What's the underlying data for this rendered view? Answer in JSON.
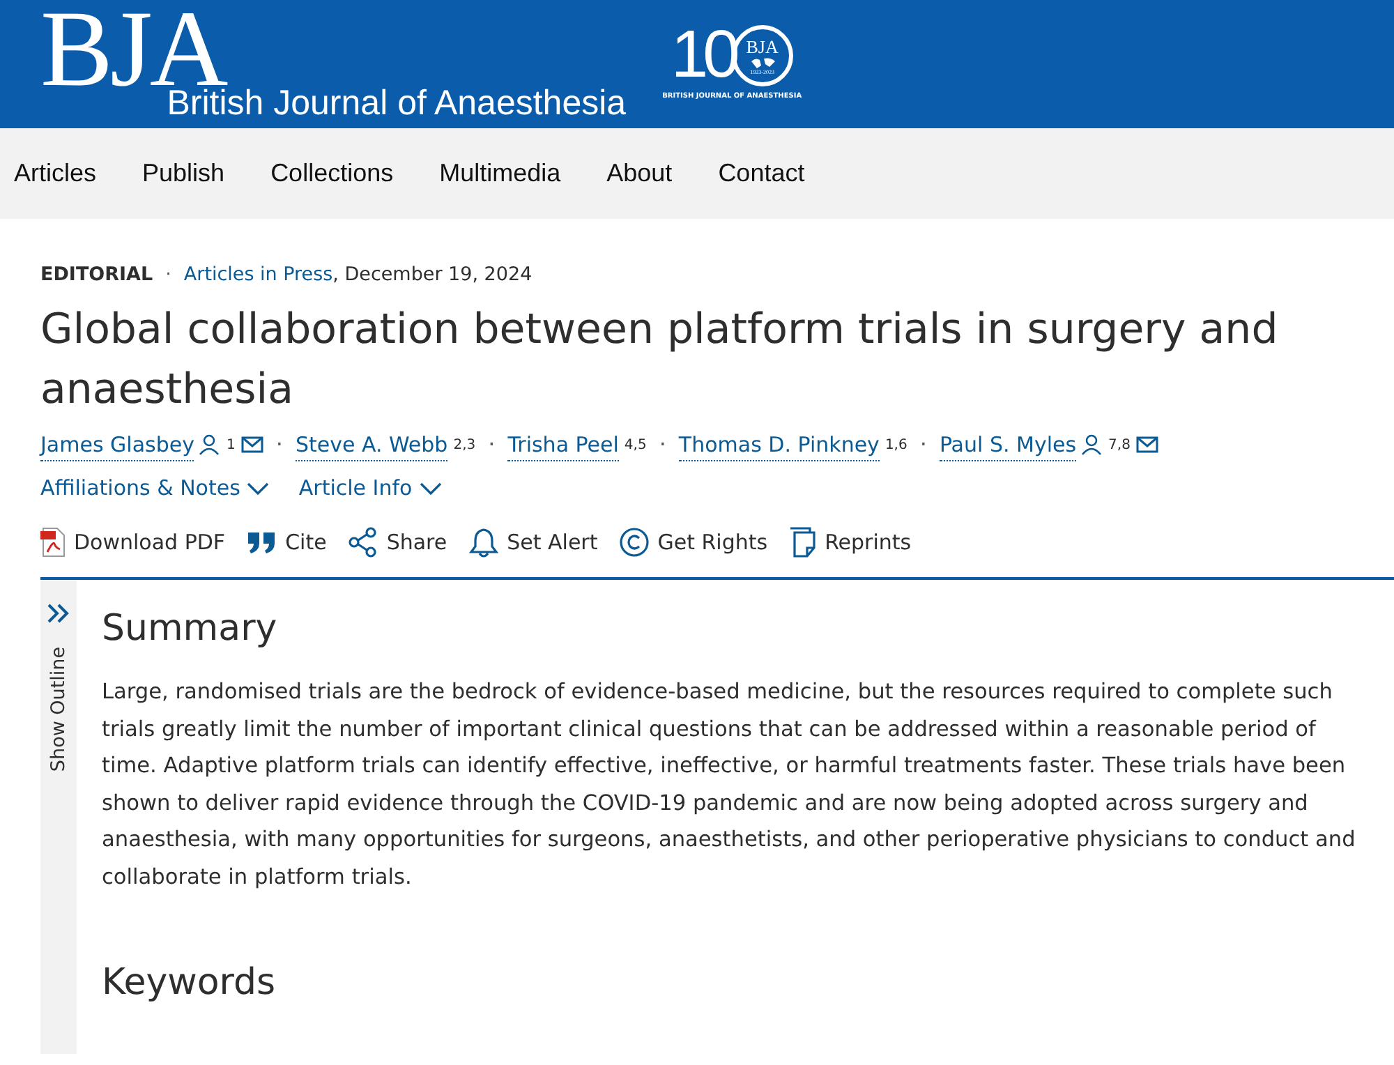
{
  "header": {
    "logo": "BJA",
    "journal": "British Journal of Anaesthesia",
    "anniversary": {
      "number": "10",
      "mark": "BJA",
      "years": "1923-2023",
      "caption": "BRITISH JOURNAL OF ANAESTHESIA"
    }
  },
  "separator": "·",
  "nav": [
    "Articles",
    "Publish",
    "Collections",
    "Multimedia",
    "About",
    "Contact"
  ],
  "article": {
    "type": "EDITORIAL",
    "section": "Articles in Press",
    "date": ", December 19, 2024",
    "title": "Global collaboration between platform trials in surgery and anaesthesia",
    "authors": [
      {
        "name": "James Glasbey",
        "person_icon": true,
        "sup": "1",
        "email_icon": true
      },
      {
        "name": "Steve A. Webb",
        "person_icon": false,
        "sup": "2,3",
        "email_icon": false
      },
      {
        "name": "Trisha Peel",
        "person_icon": false,
        "sup": "4,5",
        "email_icon": false
      },
      {
        "name": "Thomas D. Pinkney",
        "person_icon": false,
        "sup": "1,6",
        "email_icon": false
      },
      {
        "name": "Paul S. Myles",
        "person_icon": true,
        "sup": "7,8",
        "email_icon": true
      }
    ],
    "toggles": [
      "Affiliations & Notes",
      "Article Info"
    ],
    "actions": [
      {
        "kind": "pdf",
        "label": "Download PDF"
      },
      {
        "kind": "cite",
        "label": "Cite"
      },
      {
        "kind": "share",
        "label": "Share"
      },
      {
        "kind": "alert",
        "label": "Set Alert"
      },
      {
        "kind": "rights",
        "label": "Get Rights"
      },
      {
        "kind": "reprints",
        "label": "Reprints"
      }
    ]
  },
  "outline": {
    "label": "Show Outline"
  },
  "sections": [
    {
      "heading": "Summary",
      "text": "Large, randomised trials are the bedrock of evidence-based medicine, but the resources required to complete such trials greatly limit the number of important clinical questions that can be addressed within a reasonable period of time. Adaptive platform trials can identify effective, ineffective, or harmful treatments faster. These trials have been shown to deliver rapid evidence through the COVID-19 pandemic and are now being adopted across surgery and anaesthesia, with many opportunities for surgeons, anaesthetists, and other perioperative physicians to conduct and collaborate in platform trials."
    },
    {
      "heading": "Keywords"
    }
  ]
}
